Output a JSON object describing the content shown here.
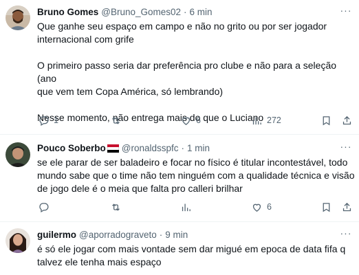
{
  "tweets": [
    {
      "name": "Bruno Gomes",
      "handle": "@Bruno_Gomes02",
      "time": "6 min",
      "paragraphs": [
        [
          "Que ganhe seu espaço em campo e não no grito ou por ser jogador",
          "internacional com grife"
        ],
        [
          "O primeiro passo seria dar preferência pro clube e não para a seleção (ano",
          "que vem tem Copa América, só lembrando)"
        ],
        [
          "Nesse momento, não entrega mais do que o Luciano"
        ]
      ],
      "replies": "1",
      "retweets": "",
      "likes": "6",
      "views": "272"
    },
    {
      "name": "Pouco Soberbo",
      "handle": "@ronaldsspfc",
      "time": "1 min",
      "paragraphs": [
        [
          "se ele parar de ser baladeiro e focar no físico é titular incontestável, todo",
          "mundo sabe que o time não tem ninguém com a qualidade técnica e visão",
          "de jogo dele é o meia que falta pro calleri brilhar"
        ]
      ],
      "replies": "",
      "retweets": "",
      "likes": "6",
      "views": ""
    },
    {
      "name": "guilermo",
      "handle": "@aporradograveto",
      "time": "9 min",
      "paragraphs": [
        [
          "é só ele jogar com mais vontade sem dar migué em epoca de data fifa q",
          "talvez ele tenha mais espaço"
        ]
      ]
    }
  ],
  "icons": {
    "reply": "reply-icon",
    "retweet": "retweet-icon",
    "like": "heart-icon",
    "views": "views-icon",
    "bookmark": "bookmark-icon",
    "share": "share-icon",
    "more": "more-icon",
    "flag": "flag-icon"
  },
  "colors": {
    "text": "#0f1419",
    "secondary": "#536471",
    "divider": "#eff3f4",
    "flag_red": "#c8102e",
    "flag_black": "#000000"
  }
}
